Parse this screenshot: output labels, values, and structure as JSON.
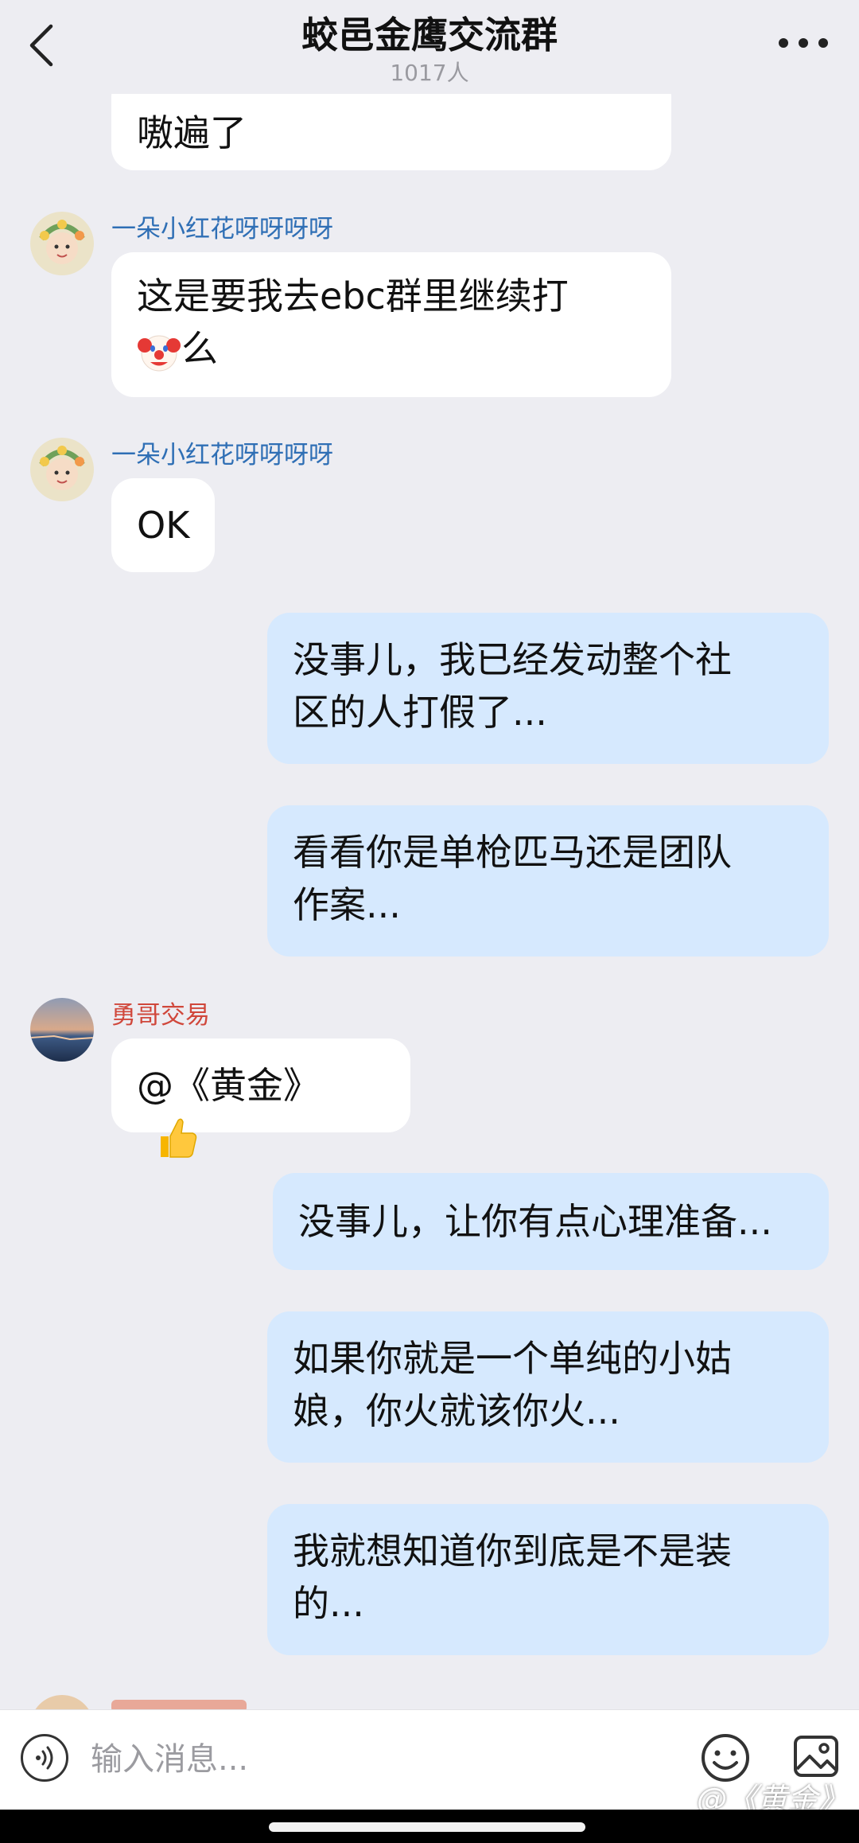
{
  "header": {
    "title": "蛟邑金鹰交流群",
    "member_count": "1017人"
  },
  "messages": [
    {
      "side": "left",
      "sender": "",
      "lines": [
        "嗷遍了"
      ]
    },
    {
      "side": "left",
      "sender": "一朵小红花呀呀呀呀",
      "lines": [
        "这是要我去ebc群里继续打",
        "么"
      ],
      "emoji": "clown"
    },
    {
      "side": "left",
      "sender": "一朵小红花呀呀呀呀",
      "lines": [
        "OK"
      ]
    },
    {
      "side": "right",
      "lines": [
        "没事儿，我已经发动整个社",
        "区的人打假了..."
      ]
    },
    {
      "side": "right",
      "lines": [
        "看看你是单枪匹马还是团队",
        "作案..."
      ]
    },
    {
      "side": "left",
      "sender": "勇哥交易",
      "lines": [
        "@《黄金》"
      ],
      "emoji": "thumbs-up"
    },
    {
      "side": "right",
      "lines": [
        "没事儿，让你有点心理准备..."
      ]
    },
    {
      "side": "right",
      "lines": [
        "如果你就是一个单纯的小姑",
        "娘，你火就该你火..."
      ]
    },
    {
      "side": "right",
      "lines": [
        "我就想知道你到底是不是装",
        "的..."
      ]
    }
  ],
  "input": {
    "placeholder": "输入消息..."
  },
  "watermark": "@《黄金》",
  "colors": {
    "background": "#EDEDF2",
    "my_bubble": "#D6E9FE",
    "other_bubble": "#FFFFFF",
    "name_blue": "#2F6FB5",
    "name_red": "#D0473B"
  }
}
